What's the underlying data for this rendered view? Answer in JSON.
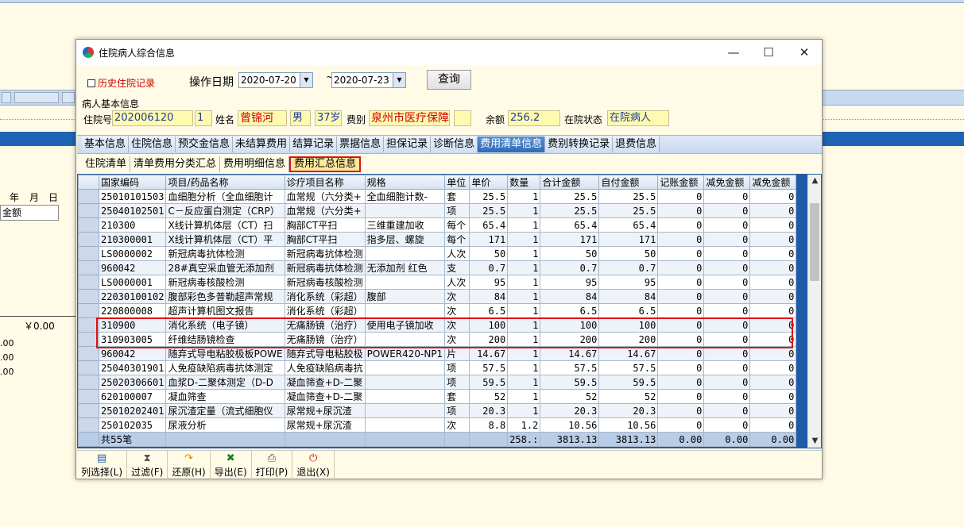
{
  "background": {
    "date_header": [
      "年",
      "月",
      "日"
    ],
    "field_label": "金额",
    "amount": "￥0.00",
    "small_values": [
      ".00",
      ".00",
      ".00"
    ]
  },
  "window": {
    "title": "住院病人综合信息",
    "controls": {
      "minimize": "—",
      "maximize": "☐",
      "close": "✕"
    }
  },
  "filter": {
    "history_label": "历史住院记录",
    "date_label": "操作日期",
    "date_from": "2020-07-20",
    "date_to": "2020-07-23",
    "tilde": "~",
    "query_button": "查询"
  },
  "patient": {
    "section_title": "病人基本信息",
    "hospital_no_label": "住院号",
    "hospital_no": "202006120",
    "times": "1",
    "name_label": "姓名",
    "name": "曾锦河",
    "gender": "男",
    "age": "37岁",
    "fee_type_label": "费别",
    "fee_type": "泉州市医疗保障",
    "balance_label": "余额",
    "balance": "256.2",
    "status_label": "在院状态",
    "status": "在院病人"
  },
  "tabs": [
    {
      "label": "基本信息"
    },
    {
      "label": "住院信息"
    },
    {
      "label": "预交金信息"
    },
    {
      "label": "未结算费用"
    },
    {
      "label": "结算记录"
    },
    {
      "label": "票据信息"
    },
    {
      "label": "担保记录"
    },
    {
      "label": "诊断信息"
    },
    {
      "label": "费用清单信息"
    },
    {
      "label": "费别转换记录"
    },
    {
      "label": "退费信息"
    }
  ],
  "subtabs": [
    {
      "label": "住院清单"
    },
    {
      "label": "清单费用分类汇总"
    },
    {
      "label": "费用明细信息"
    },
    {
      "label": "费用汇总信息"
    }
  ],
  "table": {
    "columns": [
      "国家编码",
      "项目/药品名称",
      "诊疗项目名称",
      "规格",
      "单位",
      "单价",
      "数量",
      "合计金额",
      "自付金额",
      "记账金额",
      "减免金额",
      "减免金额"
    ],
    "rows": [
      [
        "25010101503",
        "血细胞分析（全血细胞计",
        "血常规（六分类+",
        "全血细胞计数-",
        "套",
        "25.5",
        "1",
        "25.5",
        "25.5",
        "0",
        "0",
        "0"
      ],
      [
        "25040102501",
        "C－反应蛋白测定（CRP）",
        "血常规（六分类+",
        "",
        "项",
        "25.5",
        "1",
        "25.5",
        "25.5",
        "0",
        "0",
        "0"
      ],
      [
        "210300",
        "X线计算机体层（CT）扫",
        "胸部CT平扫",
        "三维重建加收",
        "每个",
        "65.4",
        "1",
        "65.4",
        "65.4",
        "0",
        "0",
        "0"
      ],
      [
        "210300001",
        "X线计算机体层（CT）平",
        "胸部CT平扫",
        "指多层、螺旋",
        "每个",
        "171",
        "1",
        "171",
        "171",
        "0",
        "0",
        "0"
      ],
      [
        "LS0000002",
        "新冠病毒抗体检测",
        "新冠病毒抗体检测",
        "",
        "人次",
        "50",
        "1",
        "50",
        "50",
        "0",
        "0",
        "0"
      ],
      [
        "960042",
        "28#真空采血管无添加剂",
        "新冠病毒抗体检测",
        "无添加剂 红色",
        "支",
        "0.7",
        "1",
        "0.7",
        "0.7",
        "0",
        "0",
        "0"
      ],
      [
        "LS0000001",
        "新冠病毒核酸检测",
        "新冠病毒核酸检测",
        "",
        "人次",
        "95",
        "1",
        "95",
        "95",
        "0",
        "0",
        "0"
      ],
      [
        "22030100102",
        "腹部彩色多普勒超声常规",
        "消化系统（彩超）",
        "腹部",
        "次",
        "84",
        "1",
        "84",
        "84",
        "0",
        "0",
        "0"
      ],
      [
        "220800008",
        "超声计算机图文报告",
        "消化系统（彩超）",
        "",
        "次",
        "6.5",
        "1",
        "6.5",
        "6.5",
        "0",
        "0",
        "0"
      ],
      [
        "310900",
        "消化系统（电子镜）",
        "无痛肠镜（治疗）",
        "使用电子镜加收",
        "次",
        "100",
        "1",
        "100",
        "100",
        "0",
        "0",
        "0"
      ],
      [
        "310903005",
        "纤维结肠镜检查",
        "无痛肠镜（治疗）",
        "",
        "次",
        "200",
        "1",
        "200",
        "200",
        "0",
        "0",
        "0"
      ],
      [
        "960042",
        "随弃式导电粘胶极板POWE",
        "随弃式导电粘胶极",
        "POWER420-NP1",
        "片",
        "14.67",
        "1",
        "14.67",
        "14.67",
        "0",
        "0",
        "0"
      ],
      [
        "25040301901",
        "人免疫缺陷病毒抗体测定",
        "人免疫缺陷病毒抗",
        "",
        "项",
        "57.5",
        "1",
        "57.5",
        "57.5",
        "0",
        "0",
        "0"
      ],
      [
        "25020306601",
        "血浆D-二聚体测定（D-D",
        "凝血筛查+D-二聚",
        "",
        "项",
        "59.5",
        "1",
        "59.5",
        "59.5",
        "0",
        "0",
        "0"
      ],
      [
        "620100007",
        "凝血筛查",
        "凝血筛查+D-二聚",
        "",
        "套",
        "52",
        "1",
        "52",
        "52",
        "0",
        "0",
        "0"
      ],
      [
        "25010202401",
        "尿沉渣定量（流式细胞仪",
        "尿常规+尿沉渣",
        "",
        "项",
        "20.3",
        "1",
        "20.3",
        "20.3",
        "0",
        "0",
        "0"
      ],
      [
        "250102035",
        "尿液分析",
        "尿常规+尿沉渣",
        "",
        "次",
        "8.8",
        "1.2",
        "10.56",
        "10.56",
        "0",
        "0",
        "0"
      ]
    ],
    "footer": {
      "count": "共55笔",
      "qty_total": "258.:",
      "total": "3813.13",
      "self_pay": "3813.13",
      "account": "0.00",
      "waive1": "0.00",
      "waive2": "0.00"
    }
  },
  "toolbar": [
    {
      "label": "列选择(L)",
      "icon": "column-select-icon",
      "glyph": "▤"
    },
    {
      "label": "过滤(F)",
      "icon": "filter-icon",
      "glyph": "⧗"
    },
    {
      "label": "还原(H)",
      "icon": "restore-icon",
      "glyph": "↷"
    },
    {
      "label": "导出(E)",
      "icon": "excel-export-icon",
      "glyph": "✖"
    },
    {
      "label": "打印(P)",
      "icon": "printer-icon",
      "glyph": "⎙"
    },
    {
      "label": "退出(X)",
      "icon": "power-icon",
      "glyph": "⏻"
    }
  ]
}
